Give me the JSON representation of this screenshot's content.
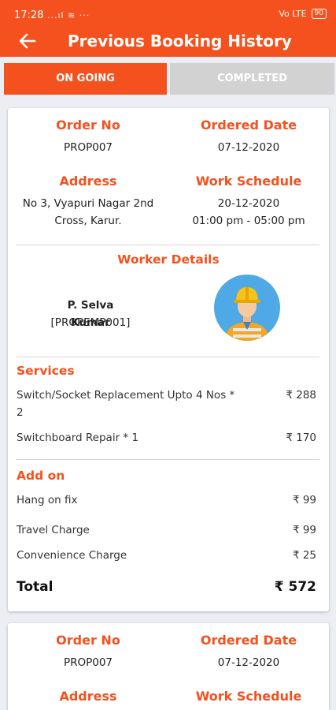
{
  "status_bar": {
    "time": "17:28",
    "signal": "...ıl ≋ ···",
    "network": "Vo LTE",
    "battery": "90"
  },
  "app_bar": {
    "title": "Previous Booking History"
  },
  "tabs": [
    {
      "label": "ON GOING"
    },
    {
      "label": "COMPLETED"
    }
  ],
  "labels": {
    "order_no": "Order No",
    "ordered_date": "Ordered Date",
    "address": "Address",
    "work_schedule": "Work Schedule",
    "worker_details": "Worker Details",
    "services": "Services",
    "add_on": "Add on",
    "total": "Total"
  },
  "booking": {
    "order_no": "PROP007",
    "ordered_date": "07-12-2020",
    "address_line1": "No 3, Vyapuri Nagar 2nd",
    "address_line2": "Cross, Karur.",
    "schedule_date": "20-12-2020",
    "schedule_time": "01:00 pm - 05:00 pm",
    "worker_name": "P. Selva Kumar",
    "worker_code": "[PROPEMP001]",
    "services": [
      {
        "name": "Switch/Socket Replacement Upto 4 Nos * 2",
        "price": "₹ 288"
      },
      {
        "name": "Switchboard Repair * 1",
        "price": "₹ 170"
      }
    ],
    "add_ons": [
      {
        "name": "Hang on fix",
        "price": "₹ 99"
      },
      {
        "name": "Travel Charge",
        "price": "₹ 99"
      },
      {
        "name": "Convenience Charge",
        "price": "₹ 25"
      }
    ],
    "total": "₹ 572"
  },
  "booking2": {
    "order_no": "PROP007",
    "ordered_date": "07-12-2020"
  },
  "colors": {
    "accent": "#f4511e",
    "inactive_tab": "#d2d2d2",
    "background": "#eceef4"
  },
  "icons": {
    "back": "arrow-left-icon",
    "avatar": "worker-avatar-icon"
  }
}
